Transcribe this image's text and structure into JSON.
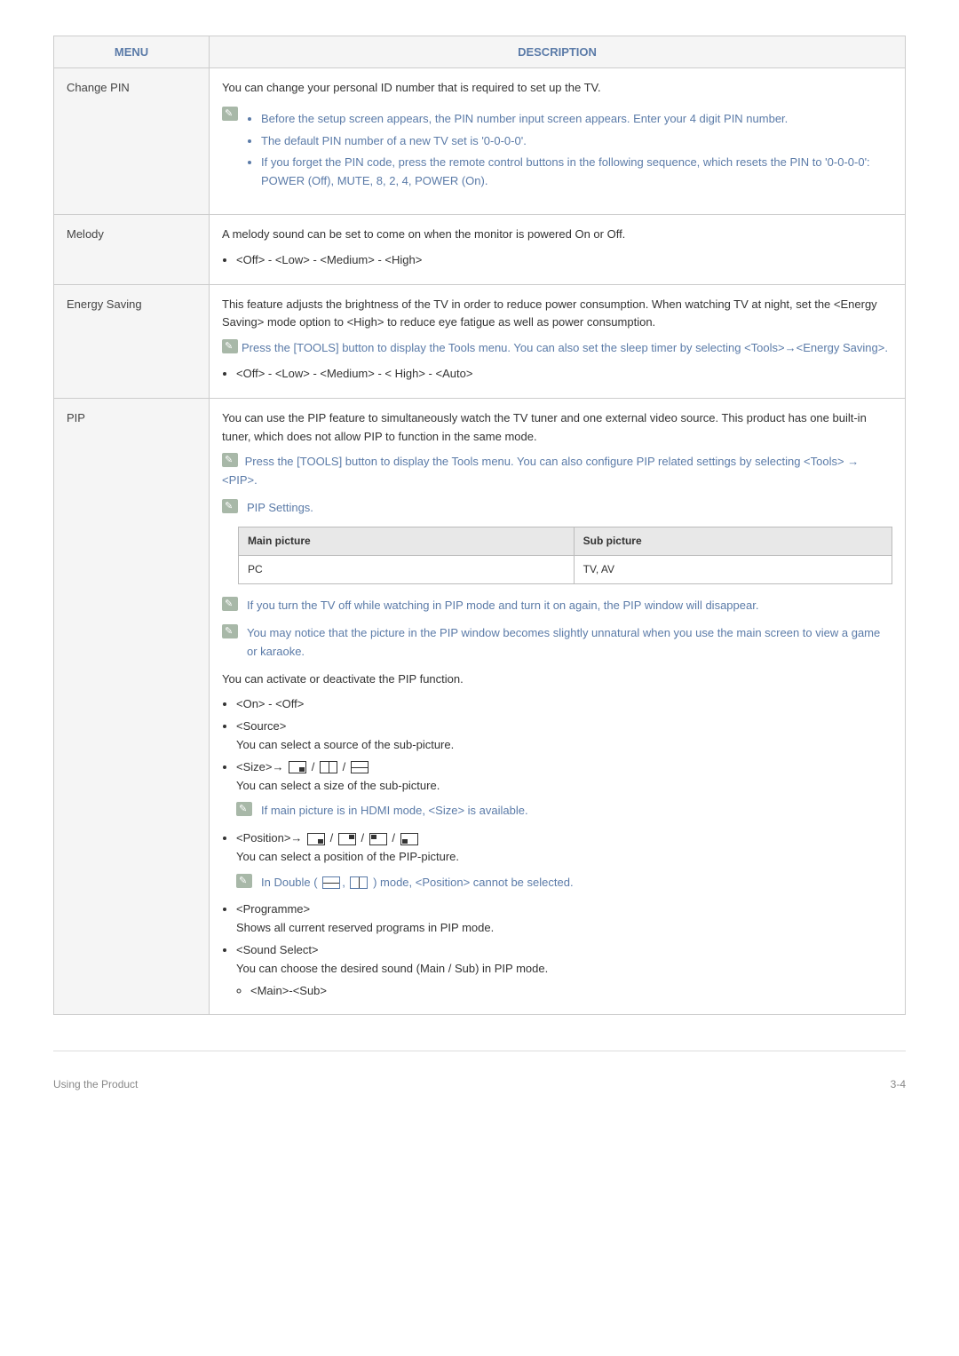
{
  "headers": {
    "menu": "MENU",
    "description": "DESCRIPTION"
  },
  "rows": {
    "change_pin": {
      "menu": "Change PIN",
      "intro": "You can change your personal ID number that is required to set up the TV.",
      "notes": [
        "Before the setup screen appears, the PIN number input screen appears. Enter your 4 digit PIN number.",
        "The default PIN number of a new TV set is '0-0-0-0'.",
        "If you forget the PIN code, press the remote control buttons in the following sequence, which resets the PIN to '0-0-0-0': POWER (Off), MUTE, 8, 2, 4, POWER (On)."
      ]
    },
    "melody": {
      "menu": "Melody",
      "intro": "A melody sound can be set to come on when the monitor is powered On or Off.",
      "options": "<Off> - <Low> - <Medium> - <High>"
    },
    "energy_saving": {
      "menu": "Energy Saving",
      "intro": "This feature adjusts the brightness of the TV in order to reduce power consumption. When watching TV at night, set the <Energy Saving> mode option to <High> to reduce eye fatigue as well as power consumption.",
      "tools_note": "Press the [TOOLS] button to display the Tools menu. You can also set the sleep timer by selecting <Tools>→<Energy Saving>.",
      "options": "<Off> - <Low> - <Medium> - < High> - <Auto>"
    },
    "pip": {
      "menu": "PIP",
      "intro": "You can use the PIP feature to simultaneously watch the TV tuner and one external video source. This product has one built-in tuner, which does not allow PIP to function in the same mode.",
      "tools_note": " Press the [TOOLS] button to display the Tools menu. You can also configure PIP related settings by selecting <Tools> → <PIP>.",
      "settings_label": "PIP Settings.",
      "subtable": {
        "h1": "Main picture",
        "h2": "Sub picture",
        "c1": "PC",
        "c2": "TV, AV"
      },
      "note1": "If you turn the TV off while watching in PIP mode and turn it on again, the PIP window will disappear.",
      "note2": "You may notice that the picture in the PIP window becomes slightly unnatural when you use the main screen to view a game or karaoke.",
      "activate": "You can activate or deactivate the PIP function.",
      "opt_onoff": "<On> - <Off>",
      "opt_source_h": "<Source>",
      "opt_source_d": "You can select a source of the sub-picture.",
      "opt_size_h": "<Size>→",
      "opt_size_d": "You can select a size of the sub-picture.",
      "size_note": "If main picture is in HDMI mode, <Size> is available.",
      "opt_pos_h": "<Position>→",
      "opt_pos_d": "You can select a position of the PIP-picture.",
      "pos_note_a": "In Double (",
      "pos_note_b": ") mode, <Position> cannot be selected.",
      "opt_prog_h": "<Programme>",
      "opt_prog_d": "Shows all current reserved programs in PIP mode.",
      "opt_sound_h": "<Sound Select>",
      "opt_sound_d": "You can choose the desired sound (Main / Sub) in PIP mode.",
      "opt_sound_sub": "<Main>-<Sub>"
    }
  },
  "footer": {
    "left": "Using the Product",
    "right": "3-4"
  }
}
